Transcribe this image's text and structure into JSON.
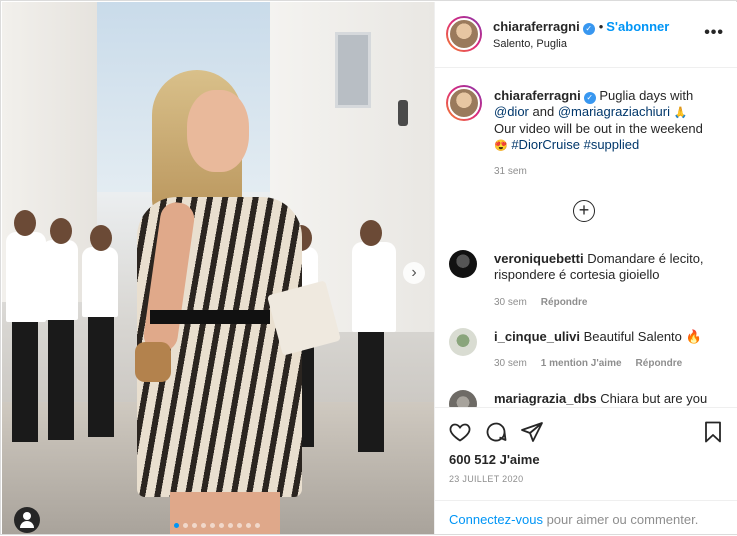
{
  "post": {
    "username": "chiaraferragni",
    "verified_symbol": "✓",
    "separator": "•",
    "follow_label": "S'abonner",
    "location": "Salento, Puglia",
    "more_label": "•••",
    "carousel": {
      "slide_count": 10,
      "active_index": 0,
      "next_label": "›"
    }
  },
  "caption": {
    "username": "chiaraferragni",
    "text_part1": "Puglia days with",
    "mention1": "@dior",
    "and": "and",
    "mention2": "@mariagraziachiuri",
    "emoji1": "🙏",
    "text_part2": "Our video will be out in the weekend",
    "emoji2": "😍",
    "hashtag1": "#DiorCruise",
    "hashtag2": "#supplied",
    "time": "31 sem",
    "load_more_label": "+"
  },
  "comments": [
    {
      "username": "veroniquebetti",
      "text": "Domandare é lecito, rispondere é cortesia gioiello",
      "time": "30 sem",
      "likes": "",
      "reply": "Répondre"
    },
    {
      "username": "i_cinque_ulivi",
      "text": "Beautiful Salento 🔥",
      "time": "30 sem",
      "likes": "1 mention J'aime",
      "reply": "Répondre"
    },
    {
      "username": "mariagrazia_dbs",
      "text": "Chiara but are you",
      "time": "",
      "likes": "",
      "reply": ""
    }
  ],
  "actions": {
    "likes": "600 512 J'aime",
    "date": "23 JUILLET 2020",
    "login_link": "Connectez-vous",
    "login_rest": "pour aimer ou commenter."
  },
  "icons": [
    "heart-icon",
    "comment-icon",
    "share-icon",
    "bookmark-icon",
    "more-options-icon",
    "add-circle-icon",
    "tagged-user-icon",
    "chevron-right-icon"
  ],
  "colors": {
    "accent": "#0095f6",
    "text": "#262626",
    "muted": "#8e8e8e",
    "link": "#00376b",
    "verified": "#3897f0"
  }
}
